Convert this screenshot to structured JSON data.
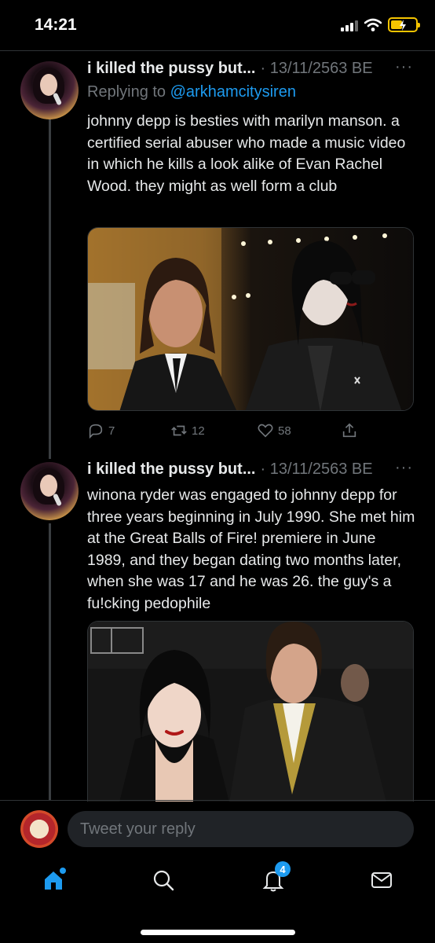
{
  "status_bar": {
    "time": "14:21"
  },
  "tweets": [
    {
      "author": "i killed the pussy but...",
      "date": "· 13/11/2563 BE",
      "more": "···",
      "replying_prefix": "Replying to",
      "replying_handle": "@arkhamcitysiren",
      "text": "johnny depp is besties with marilyn manson. a certified serial abuser who made a music video in which he kills a look alike of Evan Rachel Wood. they might as well form a club",
      "reply_count": "7",
      "retweet_count": "12",
      "like_count": "58"
    },
    {
      "author": "i killed the pussy but...",
      "date": "· 13/11/2563 BE",
      "more": "···",
      "text": "winona ryder was engaged to johnny depp for three years beginning in July 1990. She met him at the Great Balls of Fire! premiere in June 1989, and they began dating two months later, when she was 17 and he was 26. the guy's a fu!cking pedophile"
    }
  ],
  "reply_bar": {
    "placeholder": "Tweet your reply"
  },
  "tab_bar": {
    "notifications_badge": "4"
  },
  "colors": {
    "accent": "#1d9bf0",
    "background": "#000000",
    "muted": "#71767b"
  }
}
